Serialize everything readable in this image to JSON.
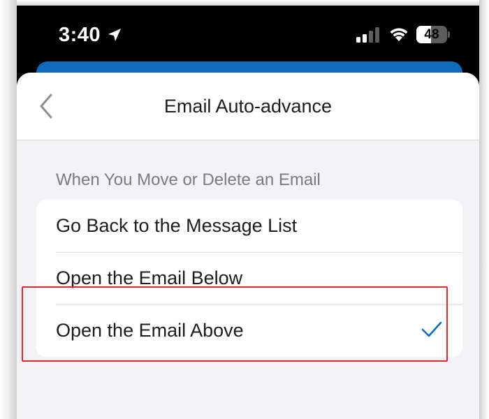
{
  "status_bar": {
    "time": "3:40",
    "battery_level": "48",
    "battery_fraction": 0.48,
    "icons": [
      "location-arrow-icon",
      "cellular-signal-icon",
      "wifi-icon",
      "battery-icon"
    ]
  },
  "nav": {
    "back_icon": "chevron-left-icon",
    "title": "Email Auto-advance"
  },
  "section": {
    "header": "When You Move or Delete an Email",
    "options": [
      {
        "label": "Go Back to the Message List",
        "selected": false
      },
      {
        "label": "Open the Email Below",
        "selected": false
      },
      {
        "label": "Open the Email Above",
        "selected": true
      }
    ]
  },
  "colors": {
    "accent": "#0f6cbd",
    "highlight": "#e0282e",
    "background": "#f2f2f7"
  }
}
